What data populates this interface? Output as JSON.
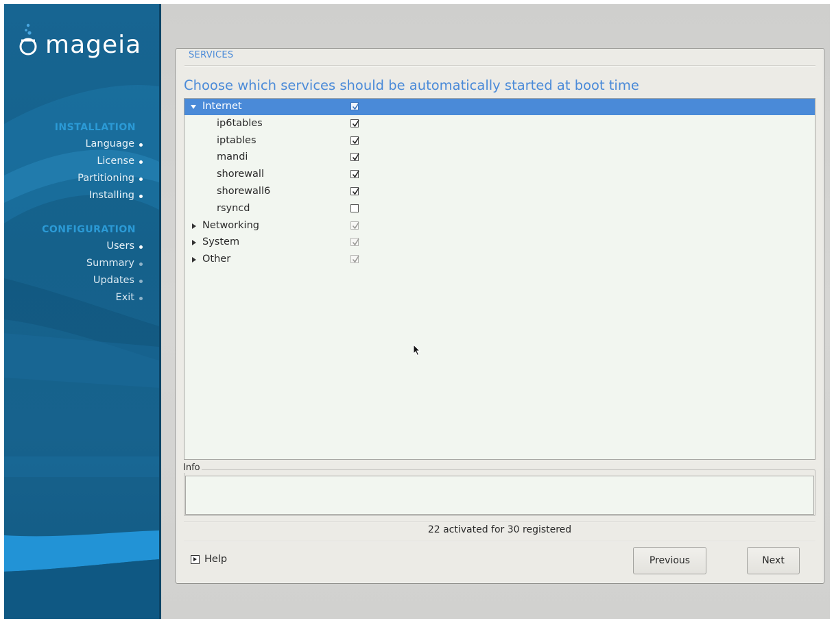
{
  "brand": {
    "logo_text": "mageia",
    "accent": "#4a8ad8",
    "sidebar_color": "#176592"
  },
  "steps": {
    "installation_heading": "INSTALLATION",
    "installation_items": [
      {
        "label": "Language",
        "state": "done"
      },
      {
        "label": "License",
        "state": "done"
      },
      {
        "label": "Partitioning",
        "state": "done"
      },
      {
        "label": "Installing",
        "state": "done"
      }
    ],
    "configuration_heading": "CONFIGURATION",
    "configuration_items": [
      {
        "label": "Users",
        "state": "done"
      },
      {
        "label": "Summary",
        "state": "pending"
      },
      {
        "label": "Updates",
        "state": "pending"
      },
      {
        "label": "Exit",
        "state": "pending"
      }
    ]
  },
  "dialog": {
    "section_title": "SERVICES",
    "prompt": "Choose which services should be automatically started at boot time",
    "tree": [
      {
        "label": "Internet",
        "kind": "group",
        "expanded": true,
        "selected": true,
        "checked": true
      },
      {
        "label": "ip6tables",
        "kind": "service",
        "checked": true
      },
      {
        "label": "iptables",
        "kind": "service",
        "checked": true
      },
      {
        "label": "mandi",
        "kind": "service",
        "checked": true
      },
      {
        "label": "shorewall",
        "kind": "service",
        "checked": true
      },
      {
        "label": "shorewall6",
        "kind": "service",
        "checked": true
      },
      {
        "label": "rsyncd",
        "kind": "service",
        "checked": false
      },
      {
        "label": "Networking",
        "kind": "group",
        "expanded": false,
        "checked": true,
        "inconsistent": true
      },
      {
        "label": "System",
        "kind": "group",
        "expanded": false,
        "checked": true,
        "inconsistent": true
      },
      {
        "label": "Other",
        "kind": "group",
        "expanded": false,
        "checked": true,
        "inconsistent": true
      }
    ],
    "info_label": "Info",
    "info_text": "",
    "status_text": "22 activated for 30 registered",
    "help_label": "Help",
    "previous_label": "Previous",
    "next_label": "Next"
  },
  "icons": {
    "logo": "mageia-cauldron-icon",
    "help": "expander-right-icon",
    "cursor": "mouse-pointer-icon",
    "check": "checkmark-icon"
  }
}
